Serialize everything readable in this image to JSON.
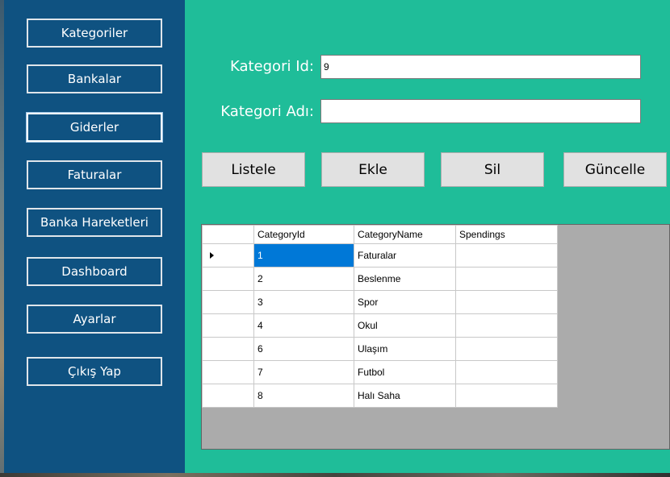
{
  "sidebar": {
    "items": [
      {
        "label": "Kategoriler"
      },
      {
        "label": "Bankalar"
      },
      {
        "label": "Giderler"
      },
      {
        "label": "Faturalar"
      },
      {
        "label": "Banka Hareketleri"
      },
      {
        "label": "Dashboard"
      },
      {
        "label": "Ayarlar"
      },
      {
        "label": "Çıkış Yap"
      }
    ]
  },
  "form": {
    "id_label": "Kategori Id:",
    "id_value": "9",
    "name_label": "Kategori Adı:",
    "name_value": ""
  },
  "actions": {
    "list": "Listele",
    "add": "Ekle",
    "delete": "Sil",
    "update": "Güncelle"
  },
  "grid": {
    "columns": [
      "CategoryId",
      "CategoryName",
      "Spendings"
    ],
    "rows": [
      {
        "id": "1",
        "name": "Faturalar",
        "spendings": ""
      },
      {
        "id": "2",
        "name": "Beslenme",
        "spendings": ""
      },
      {
        "id": "3",
        "name": "Spor",
        "spendings": ""
      },
      {
        "id": "4",
        "name": "Okul",
        "spendings": ""
      },
      {
        "id": "6",
        "name": "Ulaşım",
        "spendings": ""
      },
      {
        "id": "7",
        "name": "Futbol",
        "spendings": ""
      },
      {
        "id": "8",
        "name": "Halı Saha",
        "spendings": ""
      }
    ]
  },
  "colors": {
    "sidebar": "#0f5281",
    "main": "#1fbd99",
    "selection": "#0078d7"
  }
}
